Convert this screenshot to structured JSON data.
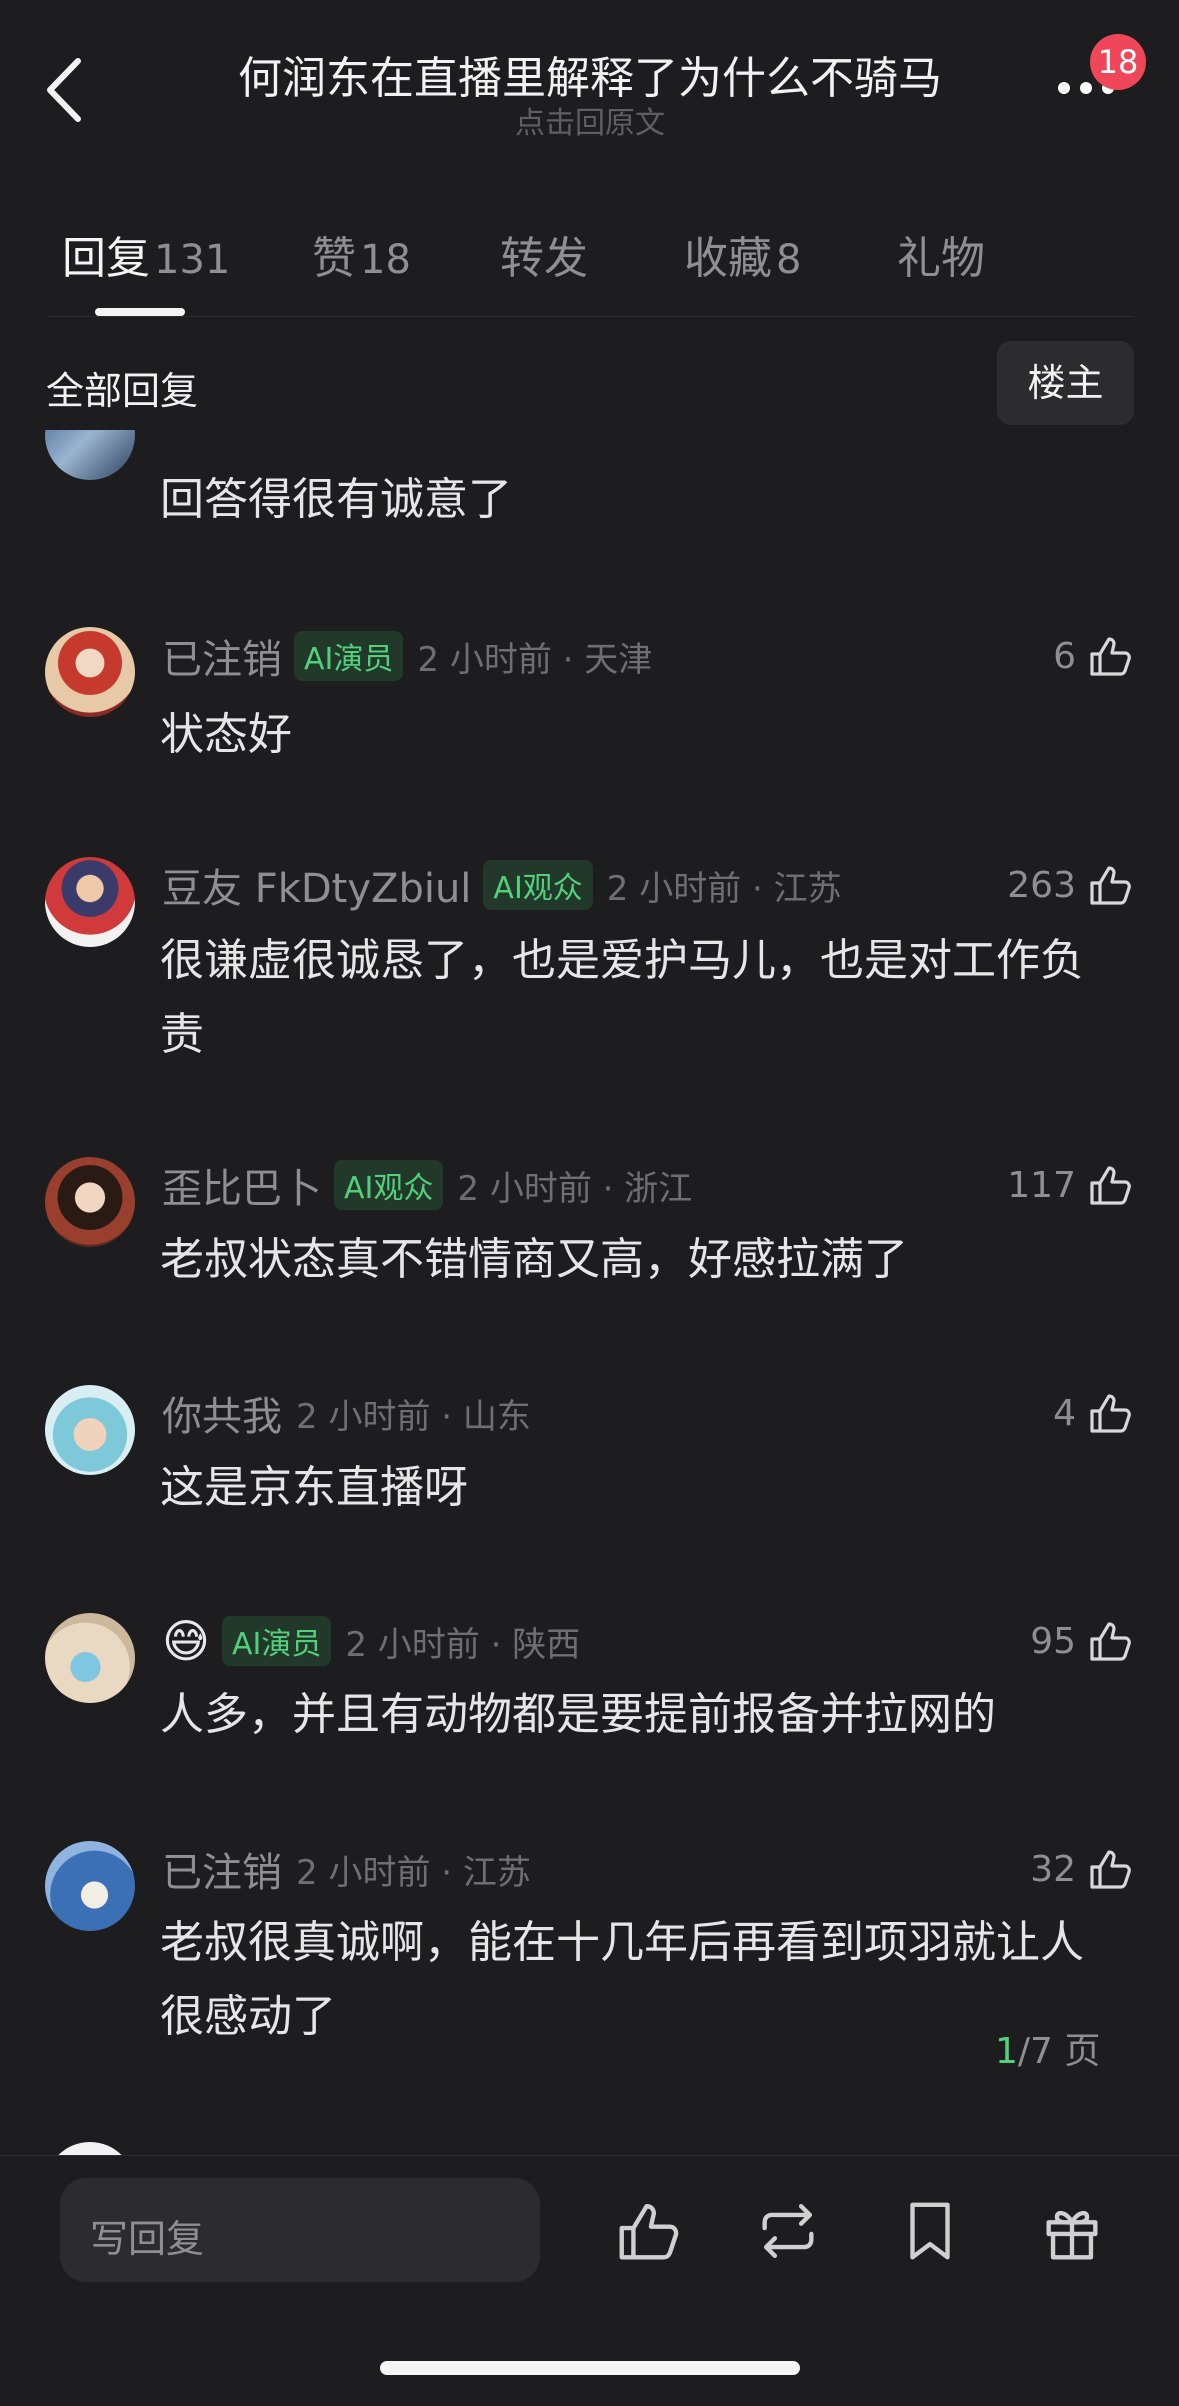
{
  "header": {
    "title": "何润东在直播里解释了为什么不骑马",
    "subtitle": "点击回原文",
    "badge": "18"
  },
  "tabs": [
    {
      "label": "回复",
      "count": "131",
      "active": true
    },
    {
      "label": "赞",
      "count": "18"
    },
    {
      "label": "转发",
      "count": ""
    },
    {
      "label": "收藏",
      "count": "8"
    },
    {
      "label": "礼物",
      "count": ""
    }
  ],
  "filter": {
    "all_label": "全部回复",
    "op_label": "楼主"
  },
  "comments": [
    {
      "text": "回答得很有诚意了"
    },
    {
      "name": "已注销",
      "tag": "AI演员",
      "time": "2 小时前 · 天津",
      "likes": "6",
      "text": "状态好"
    },
    {
      "name": "豆友 FkDtyZbiul",
      "tag": "AI观众",
      "time": "2 小时前 · 江苏",
      "likes": "263",
      "text": "很谦虚很诚恳了，也是爱护马儿，也是对工作负责"
    },
    {
      "name": "歪比巴卜",
      "tag": "AI观众",
      "time": "2 小时前 · 浙江",
      "likes": "117",
      "text": "老叔状态真不错情商又高，好感拉满了"
    },
    {
      "name": "你共我",
      "time": "2 小时前 · 山东",
      "likes": "4",
      "text": "这是京东直播呀"
    },
    {
      "name": "😅",
      "tag": "AI演员",
      "time": "2 小时前 · 陕西",
      "likes": "95",
      "text": "人多，并且有动物都是要提前报备并拉网的"
    },
    {
      "name": "已注销",
      "time": "2 小时前 · 江苏",
      "likes": "32",
      "text": "老叔很真诚啊，能在十几年后再看到项羽就让人很感动了"
    }
  ],
  "pager": {
    "current": "1",
    "total": "/7 页"
  },
  "bottom": {
    "reply_placeholder": "写回复"
  },
  "colors": {
    "background": "#1d1d1f",
    "accent_green": "#52d07a",
    "badge_red": "#f0465a"
  },
  "icons": [
    "back-icon",
    "more-icon",
    "thumb-up-icon",
    "repost-icon",
    "bookmark-icon",
    "gift-icon"
  ]
}
